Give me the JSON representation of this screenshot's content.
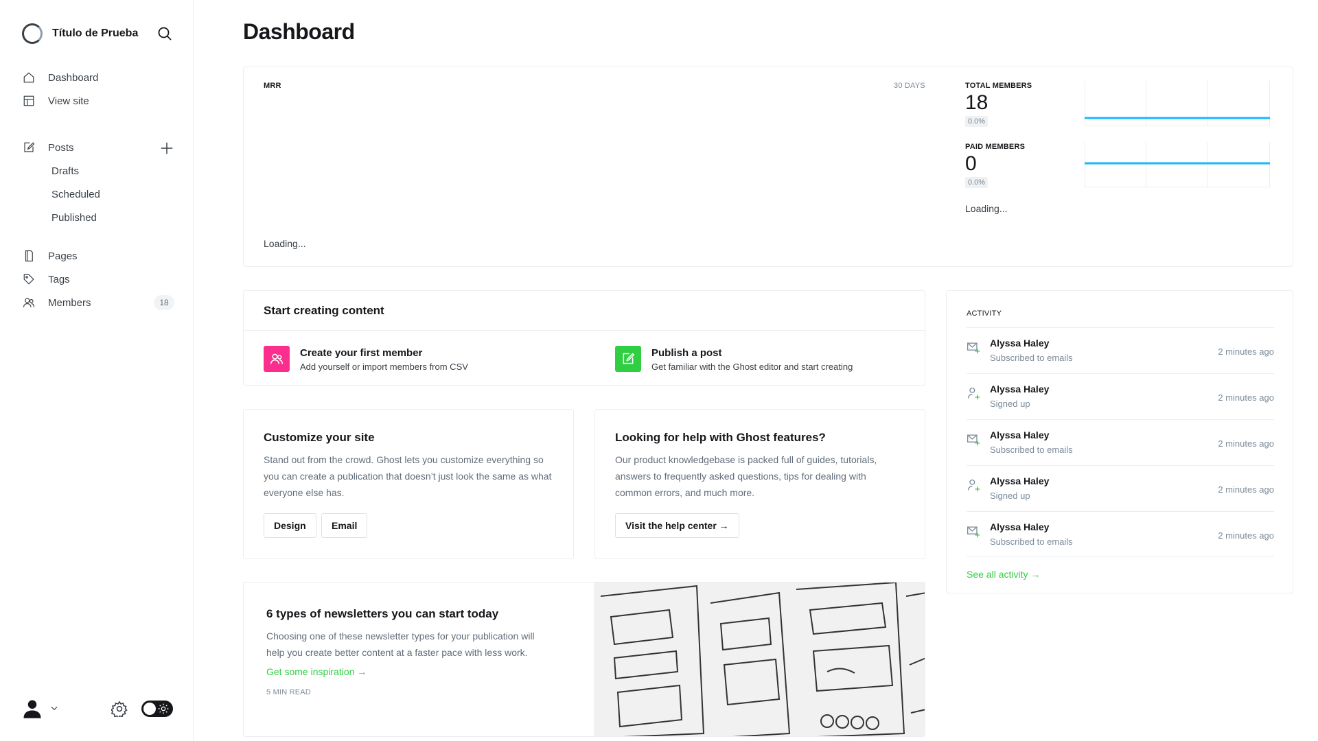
{
  "sidebar": {
    "site_title": "Título de Prueba",
    "nav": [
      {
        "label": "Dashboard",
        "icon": "home-icon"
      },
      {
        "label": "View site",
        "icon": "layout-icon"
      }
    ],
    "posts": {
      "label": "Posts",
      "icon": "edit-icon",
      "sub": [
        "Drafts",
        "Scheduled",
        "Published"
      ]
    },
    "nav2": [
      {
        "label": "Pages",
        "icon": "page-icon"
      },
      {
        "label": "Tags",
        "icon": "tag-icon"
      },
      {
        "label": "Members",
        "icon": "members-icon",
        "count": "18"
      }
    ]
  },
  "page": {
    "title": "Dashboard"
  },
  "mrr": {
    "label": "MRR",
    "range": "30 DAYS",
    "loading": "Loading...",
    "total_members": {
      "label": "TOTAL MEMBERS",
      "value": "18",
      "change": "0.0%"
    },
    "paid_members": {
      "label": "PAID MEMBERS",
      "value": "0",
      "change": "0.0%"
    },
    "members_loading": "Loading..."
  },
  "start": {
    "heading": "Start creating content",
    "items": [
      {
        "title": "Create your first member",
        "sub": "Add yourself or import members from CSV",
        "color": "#fb2d8d"
      },
      {
        "title": "Publish a post",
        "sub": "Get familiar with the Ghost editor and start creating",
        "color": "#30cf43"
      }
    ]
  },
  "customize": {
    "title": "Customize your site",
    "body": "Stand out from the crowd. Ghost lets you customize everything so you can create a publication that doesn’t just look the same as what everyone else has.",
    "design_btn": "Design",
    "email_btn": "Email"
  },
  "help": {
    "title": "Looking for help with Ghost features?",
    "body": "Our product knowledgebase is packed full of guides, tutorials, answers to frequently asked questions, tips for dealing with common errors, and much more.",
    "button": "Visit the help center →"
  },
  "newsletter": {
    "title": "6 types of newsletters you can start today",
    "body": "Choosing one of these newsletter types for your publication will help you create better content at a faster pace with less work.",
    "link": "Get some inspiration →",
    "read_time": "5 MIN READ"
  },
  "activity": {
    "label": "ACTIVITY",
    "items": [
      {
        "name": "Alyssa Haley",
        "desc": "Subscribed to emails",
        "time": "2 minutes ago",
        "icon": "mail-plus-icon"
      },
      {
        "name": "Alyssa Haley",
        "desc": "Signed up",
        "time": "2 minutes ago",
        "icon": "user-plus-icon"
      },
      {
        "name": "Alyssa Haley",
        "desc": "Subscribed to emails",
        "time": "2 minutes ago",
        "icon": "mail-plus-icon"
      },
      {
        "name": "Alyssa Haley",
        "desc": "Signed up",
        "time": "2 minutes ago",
        "icon": "user-plus-icon"
      },
      {
        "name": "Alyssa Haley",
        "desc": "Subscribed to emails",
        "time": "2 minutes ago",
        "icon": "mail-plus-icon"
      }
    ],
    "see_all": "See all activity →"
  },
  "colors": {
    "accent": "#30cf43",
    "chart_line": "#14b8ff",
    "pink": "#fb2d8d"
  }
}
